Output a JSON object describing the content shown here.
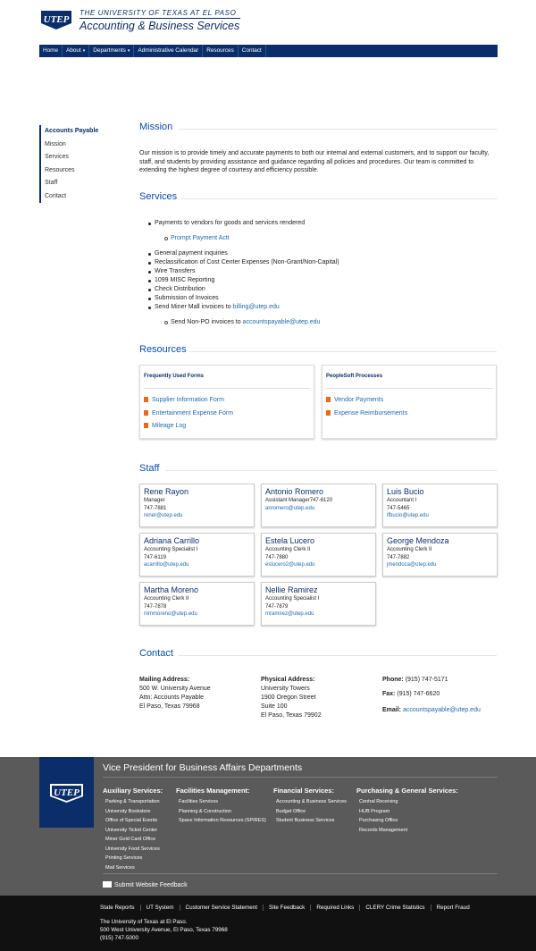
{
  "header": {
    "university": "THE UNIVERSITY OF TEXAS AT EL PASO",
    "department": "Accounting & Business Services",
    "logo_text": "UTEP"
  },
  "nav": [
    {
      "label": "Home"
    },
    {
      "label": "About",
      "caret": "▾"
    },
    {
      "label": "Departments",
      "caret": "▾"
    },
    {
      "label": "Administrative Calendar"
    },
    {
      "label": "Resources"
    },
    {
      "label": "Contact"
    }
  ],
  "banner": {
    "title": "Accounts Payable"
  },
  "sidebar": [
    {
      "label": "Accounts Payable"
    },
    {
      "label": "Mission"
    },
    {
      "label": "Services"
    },
    {
      "label": "Resources"
    },
    {
      "label": "Staff"
    },
    {
      "label": "Contact"
    }
  ],
  "mission": {
    "title": "Mission",
    "text": "Our mission is to provide timely and accurate payments to both our internal and external customers, and to support our faculty, staff, and students by providing assistance and guidance regarding all policies and procedures. Our team is committed to extending the highest degree of courtesy and efficiency possible."
  },
  "services": {
    "title": "Services",
    "item1": "Payments to vendors for goods and services rendered",
    "item1_sub": "Prompt Payment Actt",
    "items": [
      "General payment inquiries",
      "Reclassification of Cost Center Expenses (Non-Grant/Non-Capital)",
      "Wire Transfers",
      "1099 MISC Reporting",
      "Check Distribution",
      "Submission of Invoices"
    ],
    "miner_prefix": "Send Miner Mall invoices to ",
    "miner_email": "billing@utep.edu",
    "nonpo_prefix": "Send Non-PO invoices to ",
    "nonpo_email": "accountspayable@utep.edu"
  },
  "resources": {
    "title": "Resources",
    "forms_heading": "Frequently Used Forms",
    "forms": [
      "Supplier Information Form",
      "Entertainment Expense Form",
      "Mileage Log"
    ],
    "ps_heading": "PeopleSoft Processes",
    "ps": [
      "Vendor Payments",
      "Expense Reimbursements"
    ]
  },
  "staff": {
    "title": "Staff",
    "people": [
      {
        "name": "Rene Rayon",
        "title": "Manager",
        "phone": "747-7881",
        "email": "rener@utep.edu"
      },
      {
        "name": "Antonio Romero",
        "title": "Assistant Manager747-6120",
        "phone": "",
        "email": "anromero@utep.edu"
      },
      {
        "name": "Luis Bucio",
        "title": "Accountant I",
        "phone": "747-5465",
        "email": "lfbucio@utep.edu"
      },
      {
        "name": "Adriana Carrillo",
        "title": "Accounting Specialist I",
        "phone": "747-6119",
        "email": "acarrillo@utep.edu"
      },
      {
        "name": "Estela Lucero",
        "title": "Accounting Clerk II",
        "phone": "747-7880",
        "email": "eslucero2@utep.edu"
      },
      {
        "name": "George Mendoza",
        "title": "Accounting Clerk II",
        "phone": "747-7882",
        "email": "jmendoza@utep.edu"
      },
      {
        "name": "Martha Moreno",
        "title": "Accounting Clerk II",
        "phone": "747-7878",
        "email": "mmmoreno@utep.edu"
      },
      {
        "name": "Nellie Ramirez",
        "title": "Accounting Specialist I",
        "phone": "747-7879",
        "email": "mramirez@utep.edu"
      }
    ]
  },
  "contact": {
    "title": "Contact",
    "mailing_label": "Mailing Address:",
    "mailing": [
      "500 W. University Avenue",
      "Attn: Accounts Payable",
      "El Paso, Texas 79968"
    ],
    "physical_label": "Physical Address:",
    "physical": [
      "University Towers",
      "1900 Oregon Street",
      "Suite 100",
      "El Paso, Texas 79902"
    ],
    "phone_label": "Phone:",
    "phone": "(915) 747-5171",
    "fax_label": "Fax:",
    "fax": "(915) 747-6620",
    "email_label": "Email:",
    "email": "accountspayable@utep.edu"
  },
  "footer": {
    "title": "Vice President for Business Affairs Departments",
    "columns": [
      {
        "heading": "Auxiliary Services:",
        "items": [
          "Parking & Transportation",
          "University Bookstore",
          "Office of Special Events",
          "University Ticket Center",
          "Miner Gold Card Office",
          "University Food Services",
          "Printing Services",
          "Mail Services"
        ]
      },
      {
        "heading": "Facilities Management:",
        "items": [
          "Facilities Services",
          "Planning & Construction",
          "Space Information Resources (SPIRES)"
        ]
      },
      {
        "heading": "Financial Services:",
        "items": [
          "Accounting & Business Services",
          "Budget Office",
          "Student Business Services"
        ]
      },
      {
        "heading": "Purchasing & General Services:",
        "items": [
          "Central Receiving",
          "HUB Program",
          "Purchasing Office",
          "Records Management"
        ]
      }
    ],
    "feedback": "Submit Website Feedback"
  },
  "bottom": {
    "links": [
      "State Reports",
      "UT System",
      "Customer Service Statement",
      "Site Feedback",
      "Required Links",
      "CLERY Crime Statistics",
      "Report Fraud"
    ],
    "address": [
      "The University of Texas at El Paso.",
      "500 West University Avenue,  El Paso, Texas 79968",
      "(915) 747-5000"
    ]
  },
  "colors": {
    "navy": "#0b2e6b",
    "banner": "#0b4ba8",
    "link": "#1e6ab0",
    "footer": "#5a5a5a",
    "bottom": "#111111",
    "pdf": "#e56a1c"
  }
}
